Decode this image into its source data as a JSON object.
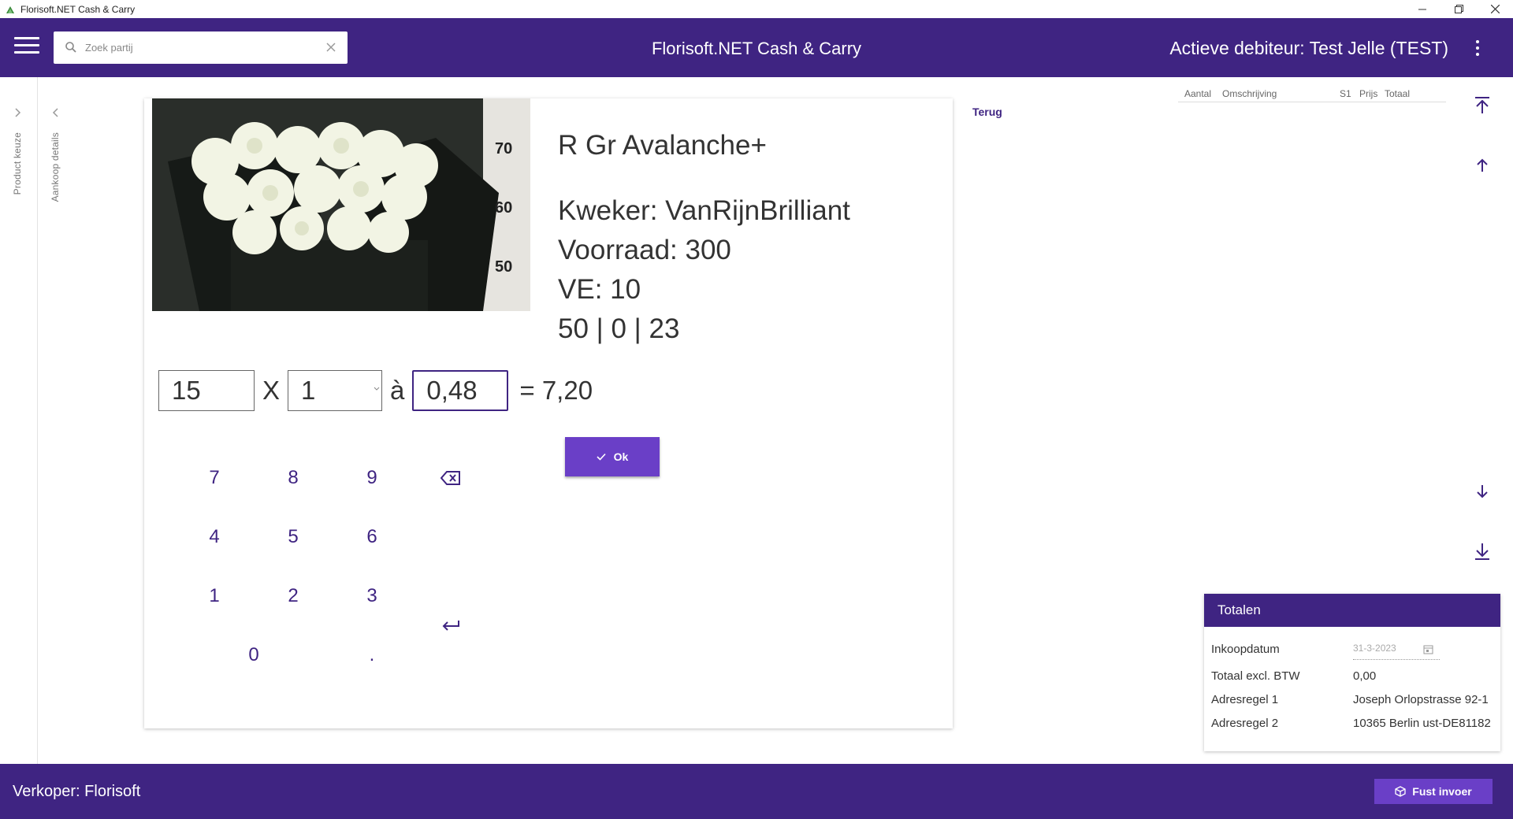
{
  "window": {
    "title": "Florisoft.NET Cash & Carry"
  },
  "header": {
    "search_placeholder": "Zoek partij",
    "app_title": "Florisoft.NET Cash & Carry",
    "debtor_label": "Actieve debiteur:",
    "debtor_value": "Test Jelle (TEST)"
  },
  "rails": {
    "product": "Product keuze",
    "details": "Aankoop details"
  },
  "product": {
    "name": "R Gr Avalanche+",
    "grower": "Kweker: VanRijnBrilliant",
    "stock": "Voorraad: 300",
    "ve": "VE: 10",
    "codes": "50 | 0 | 23",
    "ruler_marks": [
      "70",
      "60",
      "50"
    ]
  },
  "entry": {
    "quantity": "15",
    "times": "X",
    "unit": "1",
    "at": "à",
    "price": "0,48",
    "equals": "= 7,20"
  },
  "ok_label": "Ok",
  "keypad": [
    "7",
    "8",
    "9",
    "4",
    "5",
    "6",
    "1",
    "2",
    "3",
    "0",
    "."
  ],
  "terug": "Terug",
  "order_columns": [
    "Aantal",
    "Omschrijving",
    "S1",
    "Prijs",
    "Totaal"
  ],
  "totals": {
    "title": "Totalen",
    "rows": [
      {
        "label": "Inkoopdatum",
        "value": "31-3-2023"
      },
      {
        "label": "Totaal excl. BTW",
        "value": "0,00"
      },
      {
        "label": "Adresregel 1",
        "value": "Joseph Orlopstrasse 92-1"
      },
      {
        "label": "Adresregel 2",
        "value": "10365 Berlin ust-DE81182"
      }
    ]
  },
  "footer": {
    "seller_label": "Verkoper:",
    "seller_value": "Florisoft",
    "fust_label": "Fust invoer"
  },
  "colors": {
    "brand": "#3f2482",
    "accent": "#6a3fc7"
  }
}
